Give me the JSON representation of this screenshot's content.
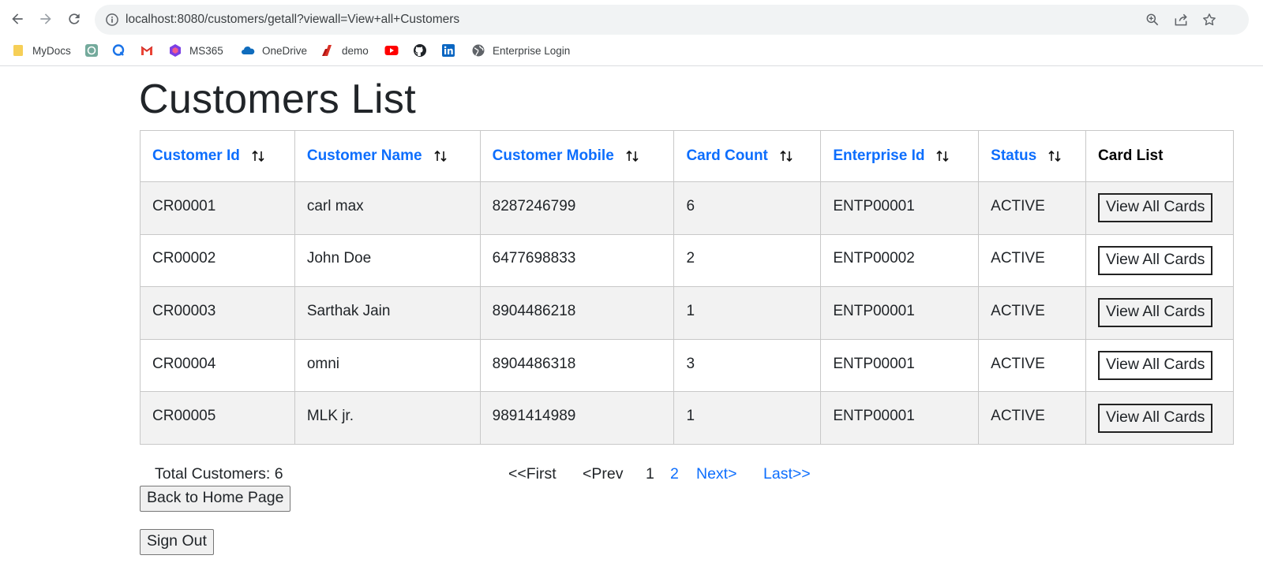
{
  "browser": {
    "url": "localhost:8080/customers/getall?viewall=View+all+Customers",
    "bookmarks": [
      {
        "label": "MyDocs",
        "icon": "folder-icon"
      },
      {
        "label": "",
        "icon": "chatgpt-icon"
      },
      {
        "label": "",
        "icon": "q-app-icon"
      },
      {
        "label": "",
        "icon": "gmail-icon"
      },
      {
        "label": "MS365",
        "icon": "ms365-icon"
      },
      {
        "label": "OneDrive",
        "icon": "onedrive-icon"
      },
      {
        "label": "demo",
        "icon": "demo-icon"
      },
      {
        "label": "",
        "icon": "youtube-icon"
      },
      {
        "label": "",
        "icon": "github-icon"
      },
      {
        "label": "",
        "icon": "linkedin-icon"
      },
      {
        "label": "Enterprise Login",
        "icon": "globe-icon"
      }
    ]
  },
  "page": {
    "title": "Customers List"
  },
  "table": {
    "headers": [
      {
        "label": "Customer Id",
        "sortable": true
      },
      {
        "label": "Customer Name",
        "sortable": true
      },
      {
        "label": "Customer Mobile",
        "sortable": true
      },
      {
        "label": "Card Count",
        "sortable": true
      },
      {
        "label": "Enterprise Id",
        "sortable": true
      },
      {
        "label": "Status",
        "sortable": true
      },
      {
        "label": "Card List",
        "sortable": false
      }
    ],
    "rows": [
      {
        "id": "CR00001",
        "name": "carl max",
        "mobile": "8287246799",
        "cards": "6",
        "enterprise": "ENTP00001",
        "status": "ACTIVE",
        "action": "View All Cards"
      },
      {
        "id": "CR00002",
        "name": "John Doe",
        "mobile": "6477698833",
        "cards": "2",
        "enterprise": "ENTP00002",
        "status": "ACTIVE",
        "action": "View All Cards"
      },
      {
        "id": "CR00003",
        "name": "Sarthak Jain",
        "mobile": "8904486218",
        "cards": "1",
        "enterprise": "ENTP00001",
        "status": "ACTIVE",
        "action": "View All Cards"
      },
      {
        "id": "CR00004",
        "name": "omni",
        "mobile": "8904486318",
        "cards": "3",
        "enterprise": "ENTP00001",
        "status": "ACTIVE",
        "action": "View All Cards"
      },
      {
        "id": "CR00005",
        "name": "MLK jr.",
        "mobile": "9891414989",
        "cards": "1",
        "enterprise": "ENTP00001",
        "status": "ACTIVE",
        "action": "View All Cards"
      }
    ]
  },
  "footer": {
    "total": "Total Customers: 6",
    "pagination": {
      "first": "<<First",
      "prev": "<Prev",
      "current_page": "1",
      "page_2": "2",
      "next": "Next>",
      "last": "Last>>"
    },
    "back_label": "Back to Home Page",
    "signout_label": "Sign Out"
  },
  "colors": {
    "link": "#0d6efd",
    "row_stripe": "#f2f2f2",
    "border": "#c8c8c8"
  }
}
